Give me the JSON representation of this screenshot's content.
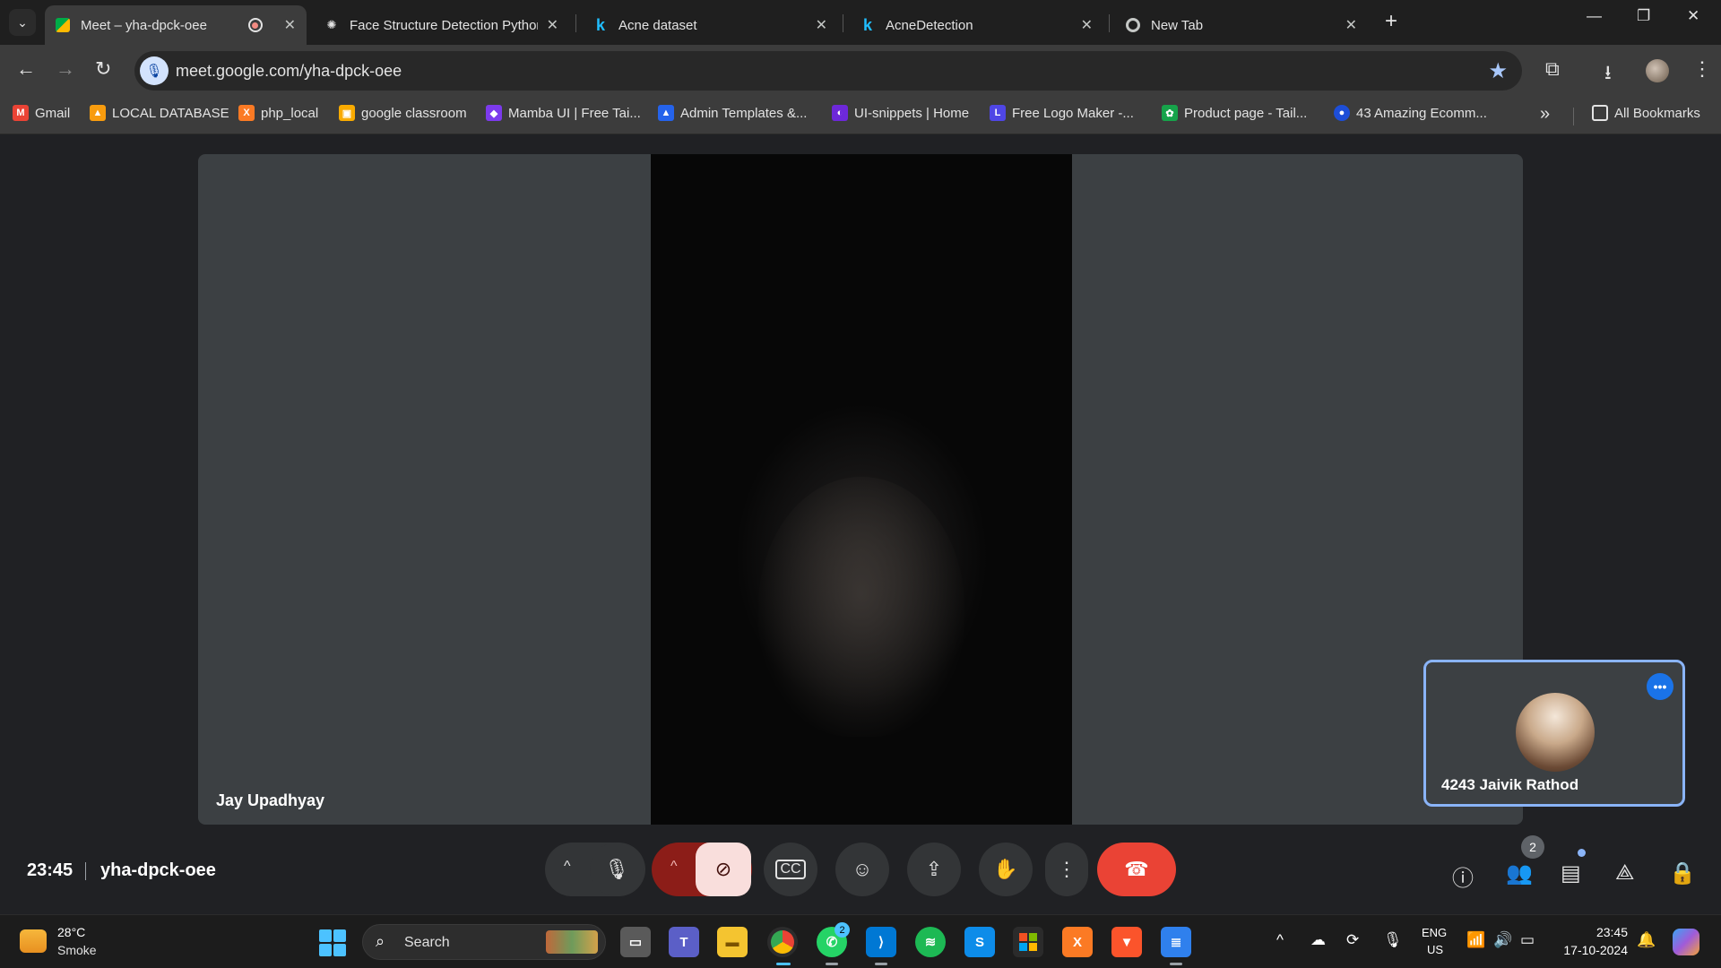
{
  "browser": {
    "tabs": [
      {
        "title": "Meet – yha-dpck-oee",
        "icon": "google-meet-icon",
        "active": true,
        "recording": true
      },
      {
        "title": "Face Structure Detection Pythor",
        "icon": "openai-icon"
      },
      {
        "title": "Acne dataset",
        "icon": "kaggle-icon"
      },
      {
        "title": "AcneDetection",
        "icon": "kaggle-icon"
      },
      {
        "title": "New Tab",
        "icon": "chrome-icon"
      }
    ],
    "url": "meet.google.com/yha-dpck-oee",
    "bookmarks": [
      {
        "label": "Gmail",
        "icon": "gmail-icon",
        "color": "#ea4335"
      },
      {
        "label": "LOCAL DATABASE",
        "icon": "phpmyadmin-icon",
        "color": "#f89c0e"
      },
      {
        "label": "php_local",
        "icon": "xampp-icon",
        "color": "#fb7a24"
      },
      {
        "label": "google classroom",
        "icon": "classroom-icon",
        "color": "#f9ab00"
      },
      {
        "label": "Mamba UI | Free Tai...",
        "icon": "mamba-icon",
        "color": "#7c3aed"
      },
      {
        "label": "Admin Templates &...",
        "icon": "admin-icon",
        "color": "#2563eb"
      },
      {
        "label": "UI-snippets | Home",
        "icon": "uisnippets-icon",
        "color": "#6d28d9"
      },
      {
        "label": "Free Logo Maker -...",
        "icon": "logomaker-icon",
        "color": "#4f46e5"
      },
      {
        "label": "Product page - Tail...",
        "icon": "tailwind-icon",
        "color": "#16a34a"
      },
      {
        "label": "43 Amazing Ecomm...",
        "icon": "ecomm-icon",
        "color": "#1d4ed8"
      }
    ],
    "all_bookmarks": "All Bookmarks"
  },
  "meet": {
    "main_participant": "Jay Upadhyay",
    "self_participant": "4243 Jaivik Rathod",
    "time": "23:45",
    "meeting_code": "yha-dpck-oee",
    "people_count": "2",
    "accent": "#8ab4f8",
    "end_call_color": "#ea4335"
  },
  "taskbar": {
    "weather_temp": "28°C",
    "weather_desc": "Smoke",
    "search_label": "Search",
    "whatsapp_badge": "2",
    "lang_line1": "ENG",
    "lang_line2": "US",
    "clock_time": "23:45",
    "clock_date": "17-10-2024"
  }
}
